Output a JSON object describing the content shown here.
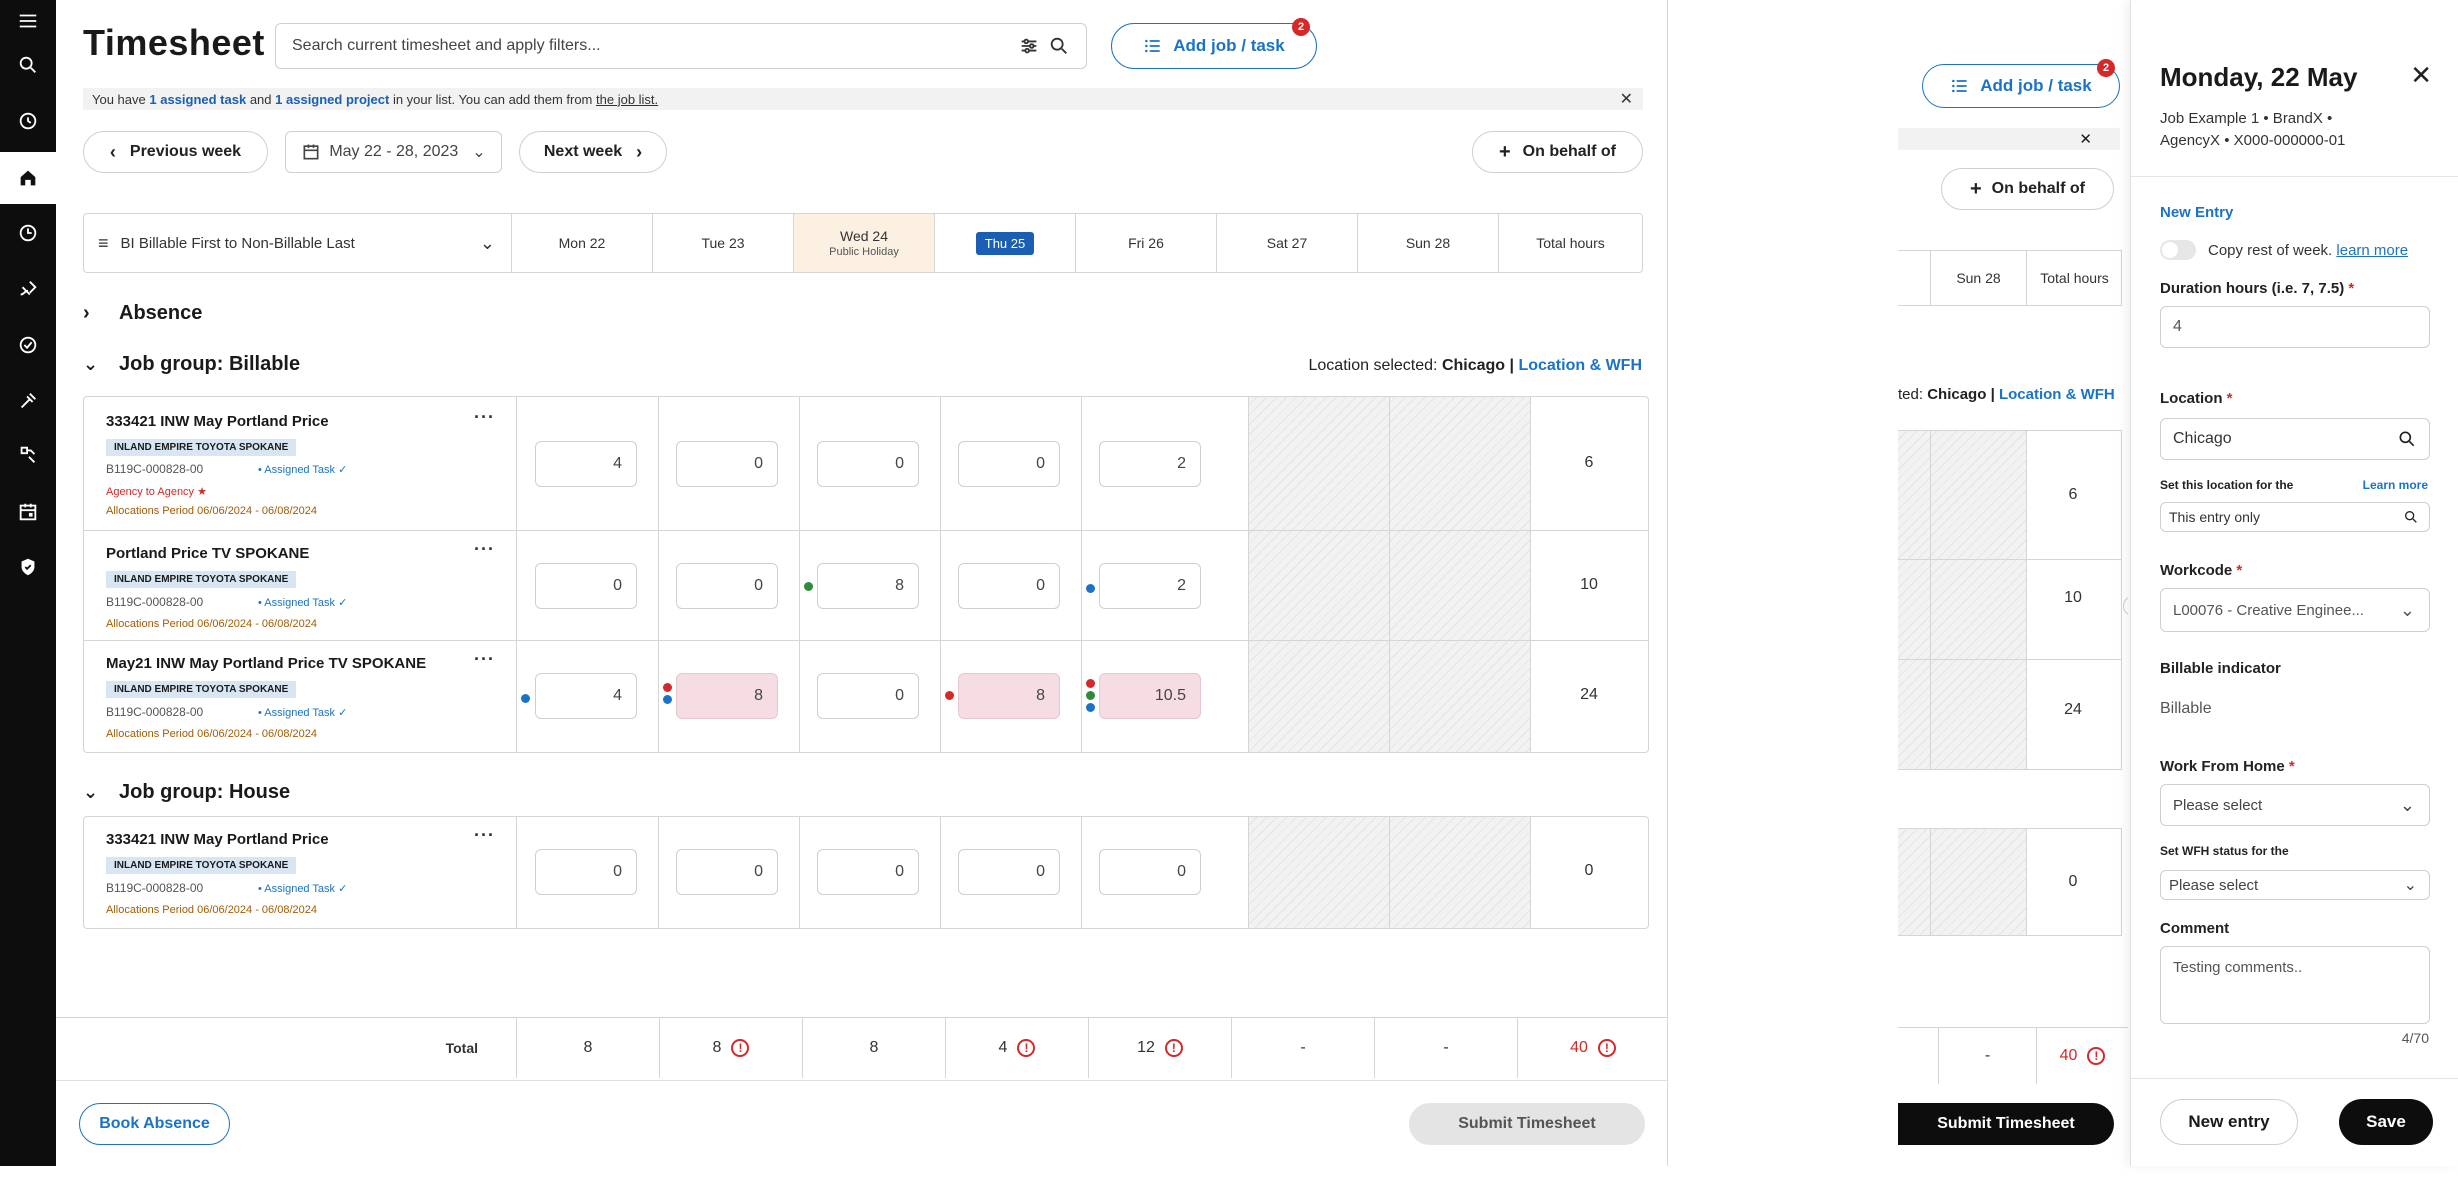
{
  "nav": {
    "items": [
      {
        "name": "menu-icon"
      },
      {
        "name": "search-icon"
      },
      {
        "name": "history-icon"
      },
      {
        "name": "home-icon"
      },
      {
        "name": "clock-icon"
      },
      {
        "name": "palette-icon"
      },
      {
        "name": "check-circle-icon"
      },
      {
        "name": "tools-icon"
      },
      {
        "name": "flow-icon"
      },
      {
        "name": "calendar-icon"
      },
      {
        "name": "shield-icon"
      }
    ]
  },
  "header": {
    "title": "Timesheet",
    "search_placeholder": "Search current timesheet and apply filters...",
    "add_job_label": "Add job / task",
    "add_job_badge": "2"
  },
  "info": {
    "pre": "You have",
    "task_link": "1 assigned task",
    "and": "and",
    "project_link": "1 assigned project",
    "mid": "in your list. You can add them from",
    "list_link": "the job list."
  },
  "week_nav": {
    "previous": "Previous week",
    "range": "May 22 - 28, 2023",
    "next": "Next week",
    "on_behalf": "On behalf of"
  },
  "columns": {
    "sort": "BI  Billable First to Non-Billable Last",
    "days": [
      {
        "label": "Mon 22",
        "sub": ""
      },
      {
        "label": "Tue 23",
        "sub": ""
      },
      {
        "label": "Wed 24",
        "sub": "Public Holiday"
      },
      {
        "label": "Thu 25",
        "sub": ""
      },
      {
        "label": "Fri 26",
        "sub": ""
      },
      {
        "label": "Sat 27",
        "sub": ""
      },
      {
        "label": "Sun 28",
        "sub": ""
      }
    ],
    "total": "Total hours"
  },
  "absence": "Absence",
  "groups": [
    {
      "title": "Job group: Billable",
      "location_prefix": "Location selected:",
      "location_value": "Chicago",
      "location_sep": "|",
      "location_link": "Location & WFH",
      "rows": [
        {
          "name": "333421 INW May Portland Price",
          "client": "INLAND EMPIRE TOYOTA SPOKANE",
          "code": "B119C-000828-00",
          "assigned": "• Assigned Task ✓",
          "agency": "Agency to Agency ★",
          "alloc": "Allocations Period 06/06/2024 - 06/08/2024",
          "values": [
            "4",
            "0",
            "0",
            "0",
            "2"
          ],
          "total": "6"
        },
        {
          "name": "Portland Price TV SPOKANE",
          "client": "INLAND EMPIRE TOYOTA SPOKANE",
          "code": "B119C-000828-00",
          "assigned": "• Assigned Task ✓",
          "agency": "",
          "alloc": "Allocations Period 06/06/2024 - 06/08/2024",
          "values": [
            "0",
            "0",
            "8",
            "0",
            "2"
          ],
          "total": "10"
        },
        {
          "name": "May21 INW May Portland Price TV SPOKANE",
          "client": "INLAND EMPIRE TOYOTA SPOKANE",
          "code": "B119C-000828-00",
          "assigned": "• Assigned Task ✓",
          "agency": "",
          "alloc": "Allocations Period 06/06/2024 - 06/08/2024",
          "values": [
            "4",
            "8",
            "0",
            "8",
            "10.5"
          ],
          "total": "24"
        }
      ]
    },
    {
      "title": "Job group: House",
      "rows": [
        {
          "name": "333421 INW May Portland Price",
          "client": "INLAND EMPIRE TOYOTA SPOKANE",
          "code": "B119C-000828-00",
          "assigned": "• Assigned Task ✓",
          "agency": "",
          "alloc": "Allocations Period 06/06/2024 - 06/08/2024",
          "values": [
            "0",
            "0",
            "0",
            "0",
            "0"
          ],
          "total": "0"
        }
      ]
    }
  ],
  "totals": {
    "label": "Total",
    "values": [
      "8",
      "8",
      "8",
      "4",
      "12",
      "-",
      "-",
      "40"
    ],
    "warnings": [
      false,
      true,
      false,
      true,
      true,
      false,
      false,
      true
    ]
  },
  "footer": {
    "book_absence": "Book Absence",
    "submit": "Submit Timesheet"
  },
  "ghost": {
    "add_job_label": "Add job / task",
    "badge": "2",
    "on_behalf": "On behalf of",
    "sun": "Sun 28",
    "total_hours": "Total hours",
    "loc_prefix": "ted:",
    "loc_value": "Chicago",
    "loc_sep": "|",
    "loc_link": "Location & WFH",
    "totals": [
      "6",
      "10",
      "24",
      "0"
    ],
    "bottom_dash": "-",
    "bottom_total": "40",
    "submit": "Submit Timesheet"
  },
  "drawer": {
    "title": "Monday, 22 May",
    "subtitle": "Job Example 1 • BrandX • AgencyX • X000-000000-01",
    "new_entry": "New Entry",
    "copy_label": "Copy rest of week.",
    "copy_link": "learn more",
    "duration_label": "Duration hours (i.e. 7, 7.5)",
    "duration_value": "4",
    "location_label": "Location",
    "location_value": "Chicago",
    "set_location_label": "Set this location for the",
    "learn_more": "Learn more",
    "entry_only": "This entry only",
    "workcode_label": "Workcode",
    "workcode_value": "L00076 - Creative Enginee...",
    "billable_label": "Billable indicator",
    "billable_value": "Billable",
    "wfh_label": "Work From Home",
    "wfh_value": "Please select",
    "wfh_status_label": "Set WFH status for the",
    "wfh_status_value": "Please select",
    "comment_label": "Comment",
    "comment_placeholder": "Testing comments..",
    "counter": "4/70",
    "new_entry_button": "New entry",
    "save_button": "Save",
    "required_mark": "*"
  }
}
